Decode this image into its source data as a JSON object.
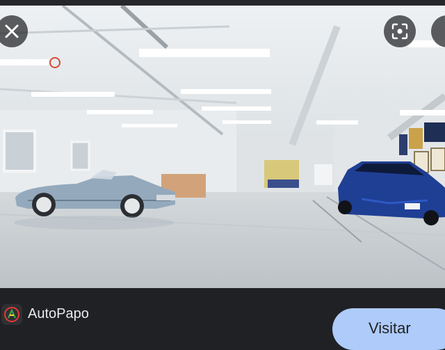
{
  "viewer": {
    "close_icon": "close-icon",
    "lens_icon": "lens-icon",
    "image_description_visible": false
  },
  "source": {
    "name": "AutoPapo",
    "logo_icon": "autopapo-logo-icon",
    "visit_label": "Visitar",
    "accent_color": "#aecbfa"
  }
}
